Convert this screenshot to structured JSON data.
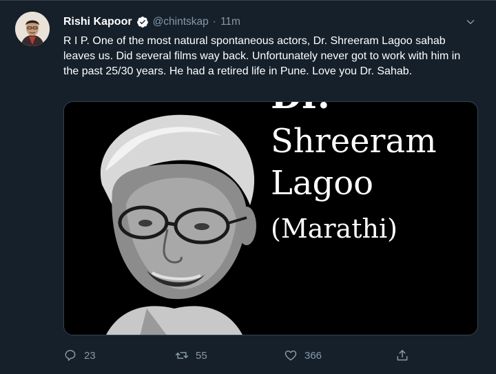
{
  "author": {
    "name": "Rishi Kapoor",
    "handle": "@chintskap",
    "separator": "·",
    "time": "11m",
    "verified": true
  },
  "tweet": {
    "text": "R I P. One of the most natural spontaneous actors, Dr. Shreeram Lagoo sahab leaves us. Did several films way back. Unfortunately never got to work with him in the past 25/30 years. He had a retired life in Pune. Love you Dr. Sahab."
  },
  "media": {
    "line1": "Dr.",
    "line2": "Shreeram",
    "line3": "Lagoo",
    "line4": "(Marathi)"
  },
  "actions": {
    "reply_count": "23",
    "retweet_count": "55",
    "like_count": "366"
  },
  "icons": {
    "verified": "verified-badge-icon",
    "caret": "chevron-down-icon",
    "reply": "reply-icon",
    "retweet": "retweet-icon",
    "like": "heart-icon",
    "share": "share-icon"
  },
  "colors": {
    "background": "#15202b",
    "secondary_text": "#8899a6",
    "border": "#38444d"
  }
}
